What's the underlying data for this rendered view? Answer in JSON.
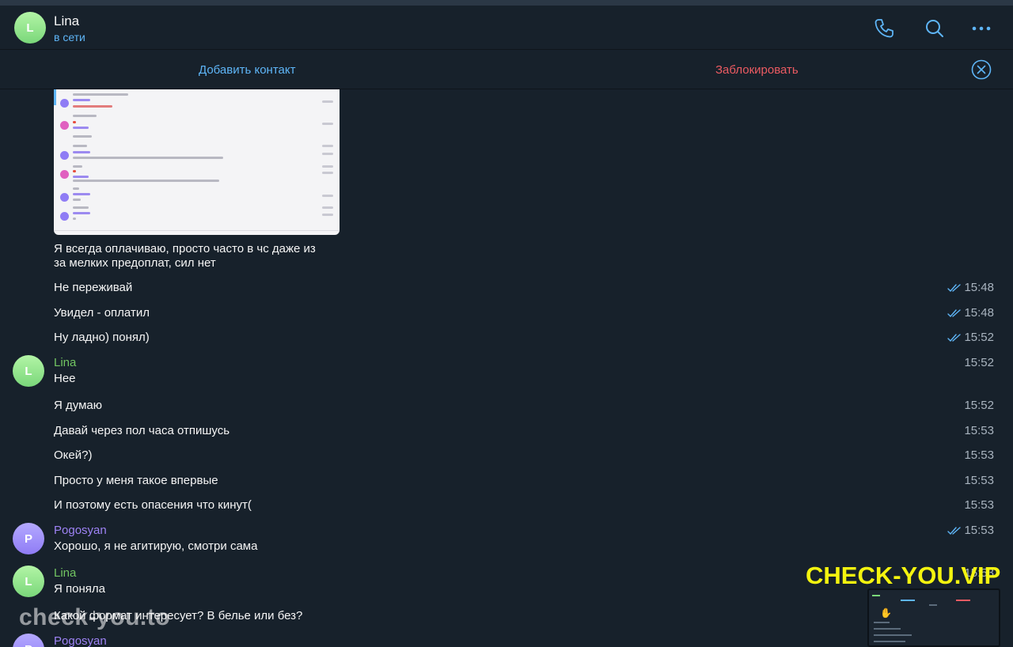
{
  "header": {
    "avatar_letter": "L",
    "name": "Lina",
    "status": "в сети"
  },
  "actions": {
    "add_contact": "Добавить контакт",
    "block": "Заблокировать"
  },
  "messages": [
    {
      "text_l1": "Я всегда оплачиваю, просто часто в чс даже из",
      "text_l2": "за мелких предоплат, сил нет"
    },
    {
      "text": "Не переживай",
      "time": "15:48",
      "read": true
    },
    {
      "text": "Увидел - оплатил",
      "time": "15:48",
      "read": true
    },
    {
      "text": "Ну ладно) понял)",
      "time": "15:52",
      "read": true
    },
    {
      "sender": "Lina",
      "avatar_letter": "L",
      "text": "Нее",
      "time": "15:52"
    },
    {
      "text": "Я думаю",
      "time": "15:52"
    },
    {
      "text": "Давай через пол часа отпишусь",
      "time": "15:53"
    },
    {
      "text": "Окей?)",
      "time": "15:53"
    },
    {
      "text": "Просто у меня такое впервые",
      "time": "15:53"
    },
    {
      "text": "И поэтому есть опасения что кинут(",
      "time": "15:53"
    },
    {
      "sender": "Pogosyan",
      "avatar_letter": "P",
      "text": "Хорошо, я не агитирую, смотри сама",
      "time": "15:53",
      "read": true
    },
    {
      "sender": "Lina",
      "avatar_letter": "L",
      "text": "Я поняла",
      "time": "15:53"
    },
    {
      "text": "Какой формат интересует? В белье или без?"
    },
    {
      "sender": "Pogosyan",
      "avatar_letter": "P"
    }
  ],
  "watermarks": {
    "left": "check-you.to",
    "right": "CHECK-YOU.VIP"
  },
  "colors": {
    "background": "#17212b",
    "accent": "#5eb5f7",
    "danger": "#ec5b62",
    "lina": "#72c562",
    "pogosyan": "#9e83f5"
  }
}
